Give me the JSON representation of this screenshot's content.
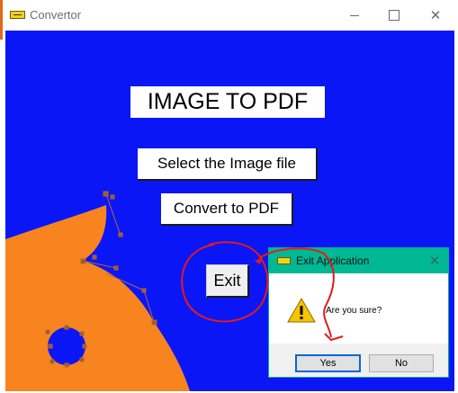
{
  "window": {
    "title": "Convertor",
    "controls": {
      "minimize": "minimize-icon",
      "maximize": "maximize-icon",
      "close": "close-icon"
    }
  },
  "main": {
    "heading": "IMAGE TO PDF",
    "select_button": "Select the Image file",
    "convert_button": "Convert to PDF",
    "exit_button": "Exit",
    "colors": {
      "background": "#0a16f6",
      "shape": "#f8841f"
    }
  },
  "dialog": {
    "title": "Exit Application",
    "message": "Are you sure?",
    "yes": "Yes",
    "no": "No",
    "icon": "warning-icon",
    "colors": {
      "titlebar": "#00b894"
    }
  },
  "annotations": {
    "color": "#e31a1a"
  }
}
